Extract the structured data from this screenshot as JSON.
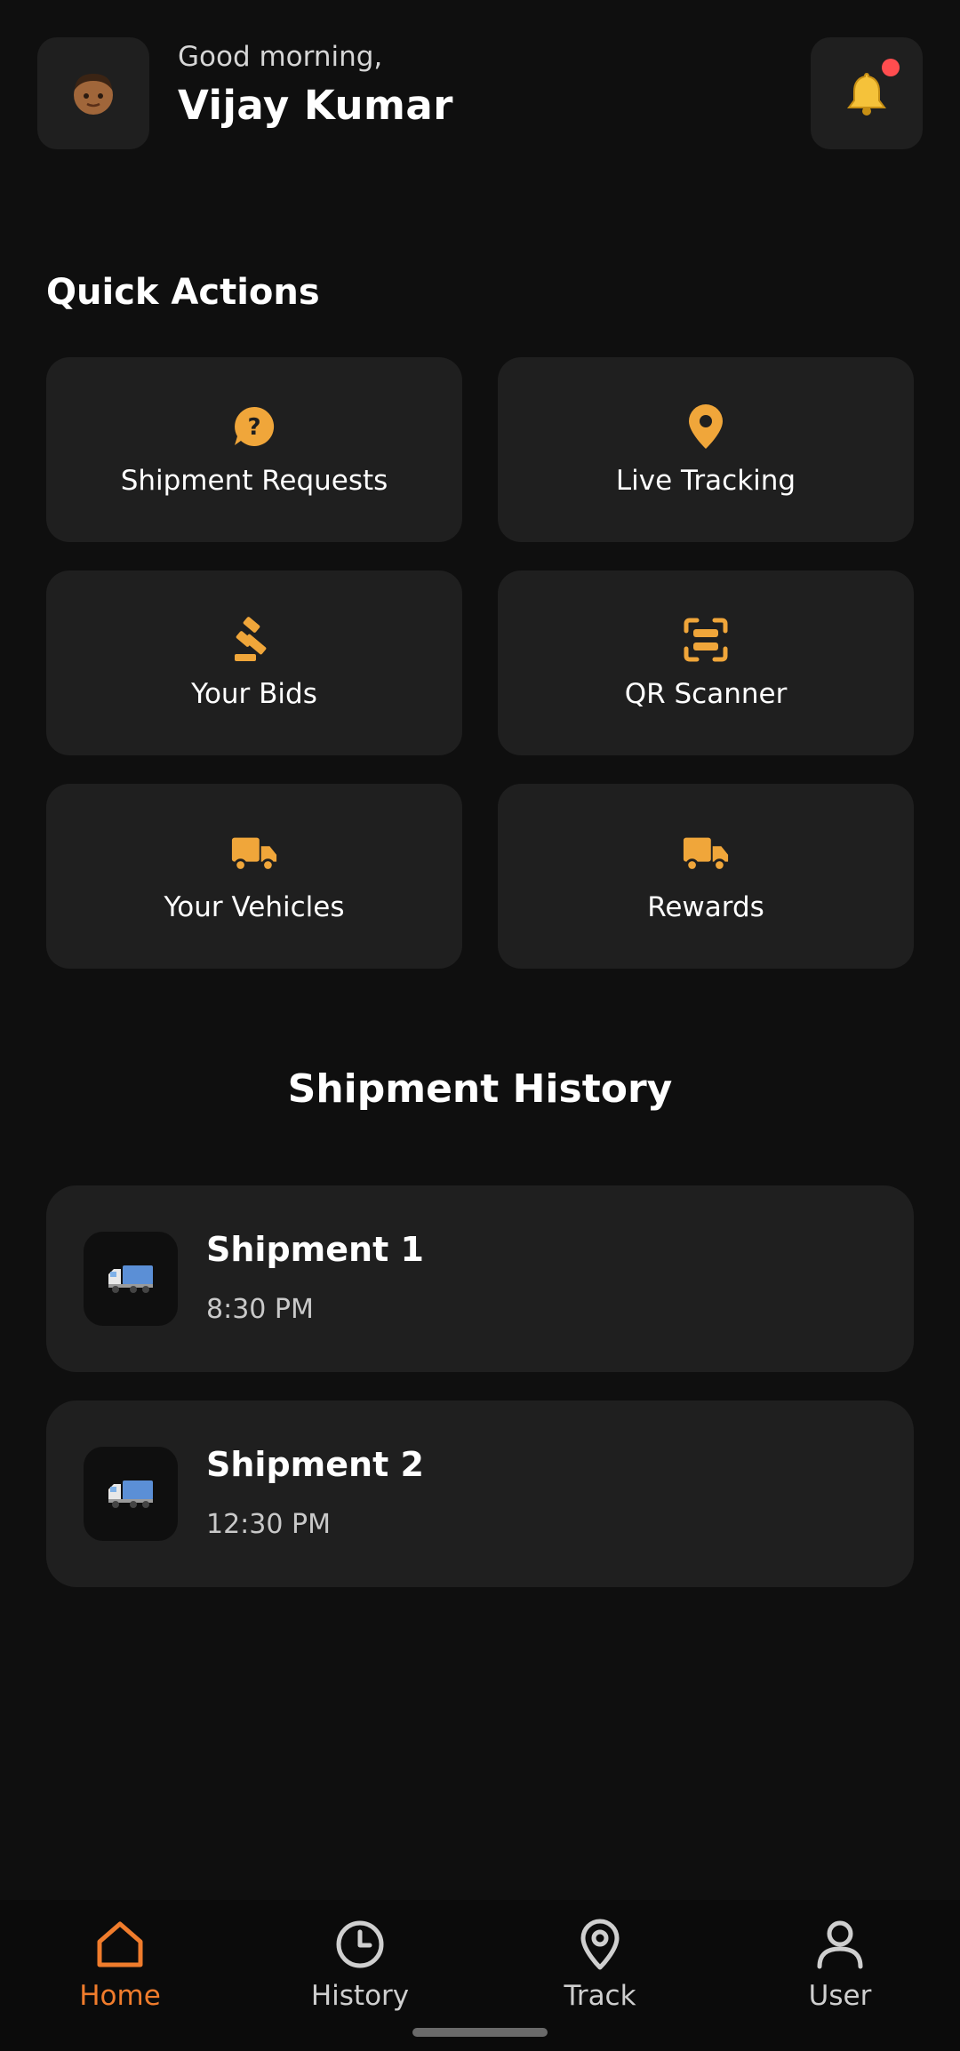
{
  "colors": {
    "accent": "#f0a63a",
    "nav_active": "#f07c2c",
    "background": "#0f0f0f",
    "card": "#1f1f1f",
    "badge": "#ff4d4f"
  },
  "header": {
    "greeting": "Good morning,",
    "user_name": "Vijay Kumar",
    "avatar_icon": "person-avatar-icon",
    "notification_icon": "bell-icon"
  },
  "quick_actions": {
    "title": "Quick Actions",
    "items": [
      {
        "label": "Shipment Requests",
        "icon": "question-chat-icon"
      },
      {
        "label": "Live Tracking",
        "icon": "map-pin-icon"
      },
      {
        "label": "Your Bids",
        "icon": "gavel-icon"
      },
      {
        "label": "QR Scanner",
        "icon": "scan-icon"
      },
      {
        "label": "Your Vehicles",
        "icon": "truck-icon"
      },
      {
        "label": "Rewards",
        "icon": "truck-icon"
      }
    ]
  },
  "history": {
    "title": "Shipment History",
    "items": [
      {
        "name": "Shipment 1",
        "time": "8:30 PM"
      },
      {
        "name": "Shipment 2",
        "time": "12:30 PM"
      }
    ]
  },
  "bottom_nav": {
    "items": [
      {
        "label": "Home",
        "icon": "home-icon",
        "active": true
      },
      {
        "label": "History",
        "icon": "clock-icon",
        "active": false
      },
      {
        "label": "Track",
        "icon": "map-pin-icon",
        "active": false
      },
      {
        "label": "User",
        "icon": "user-icon",
        "active": false
      }
    ]
  }
}
